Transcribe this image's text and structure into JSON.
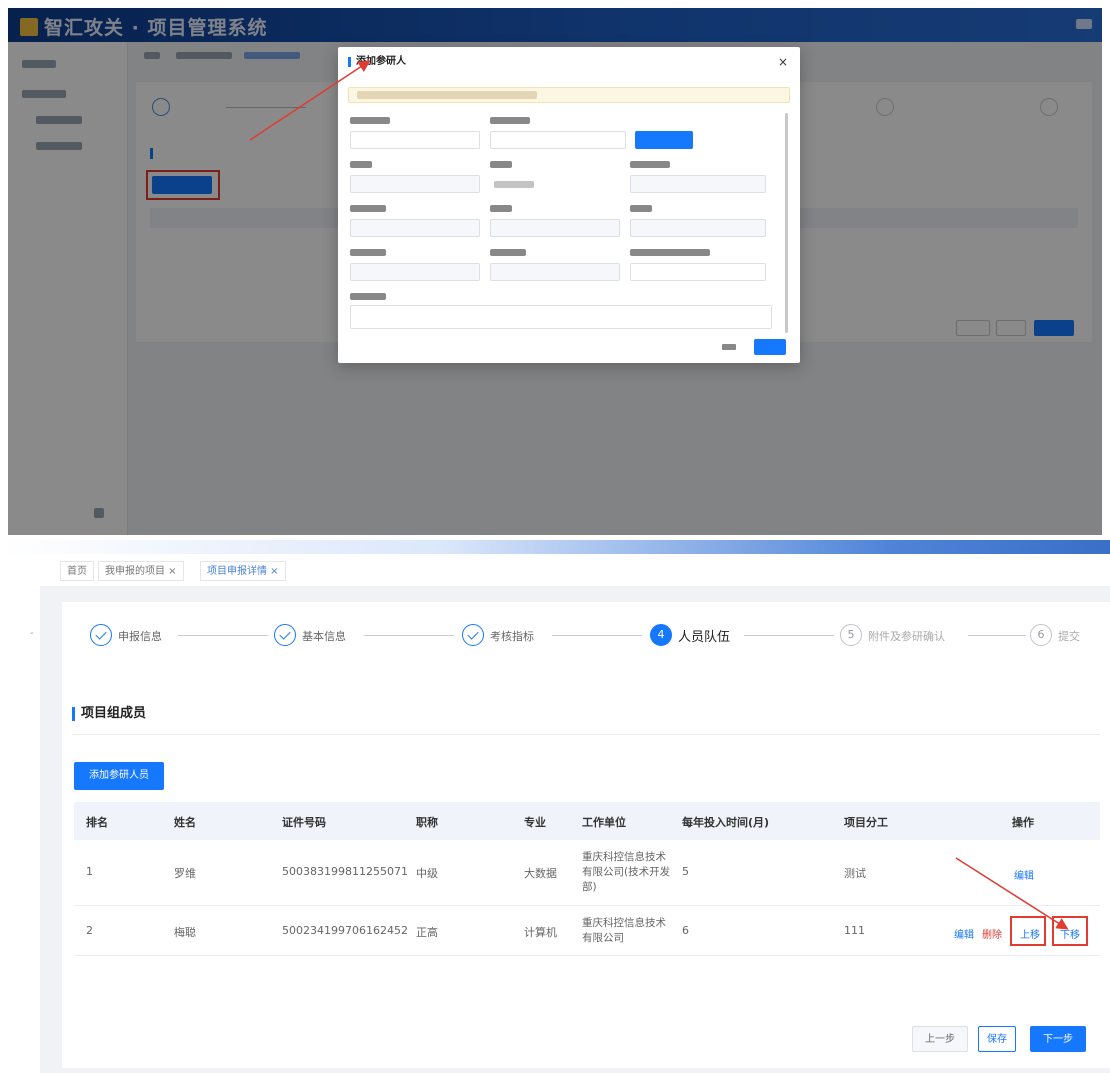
{
  "top": {
    "app_title": "智汇攻关 · 项目管理系统",
    "modal": {
      "title": "添加参研人",
      "close": "×"
    }
  },
  "bottom": {
    "tabs": [
      "首页",
      "我申报的项目 ×",
      "项目申报详情 ×"
    ],
    "steps": [
      {
        "label": "申报信息",
        "status": "done"
      },
      {
        "label": "基本信息",
        "status": "done"
      },
      {
        "label": "考核指标",
        "status": "done"
      },
      {
        "number": "4",
        "label": "人员队伍",
        "status": "active"
      },
      {
        "number": "5",
        "label": "附件及参研确认",
        "status": "wait"
      },
      {
        "number": "6",
        "label": "提交",
        "status": "wait"
      }
    ],
    "section_title": "项目组成员",
    "add_button": "添加参研人员",
    "columns": [
      "排名",
      "姓名",
      "证件号码",
      "职称",
      "专业",
      "工作单位",
      "每年投入时间(月)",
      "项目分工",
      "操作"
    ],
    "rows": [
      {
        "rank": "1",
        "name": "罗维",
        "id_no": "500383199811255071",
        "title": "中级",
        "major": "大数据",
        "unit": "重庆科控信息技术有限公司(技术开发部)",
        "months": "5",
        "role": "测试",
        "ops": [
          "编辑"
        ]
      },
      {
        "rank": "2",
        "name": "梅聪",
        "id_no": "500234199706162452",
        "title": "正高",
        "major": "计算机",
        "unit": "重庆科控信息技术有限公司",
        "months": "6",
        "role": "111",
        "ops": [
          "编辑",
          "删除",
          "上移",
          "下移"
        ]
      }
    ],
    "pager": {
      "prev": "上一步",
      "save": "保存",
      "next": "下一步"
    }
  },
  "colors": {
    "primary": "#1677ff",
    "annotation_red": "#e03c31"
  }
}
